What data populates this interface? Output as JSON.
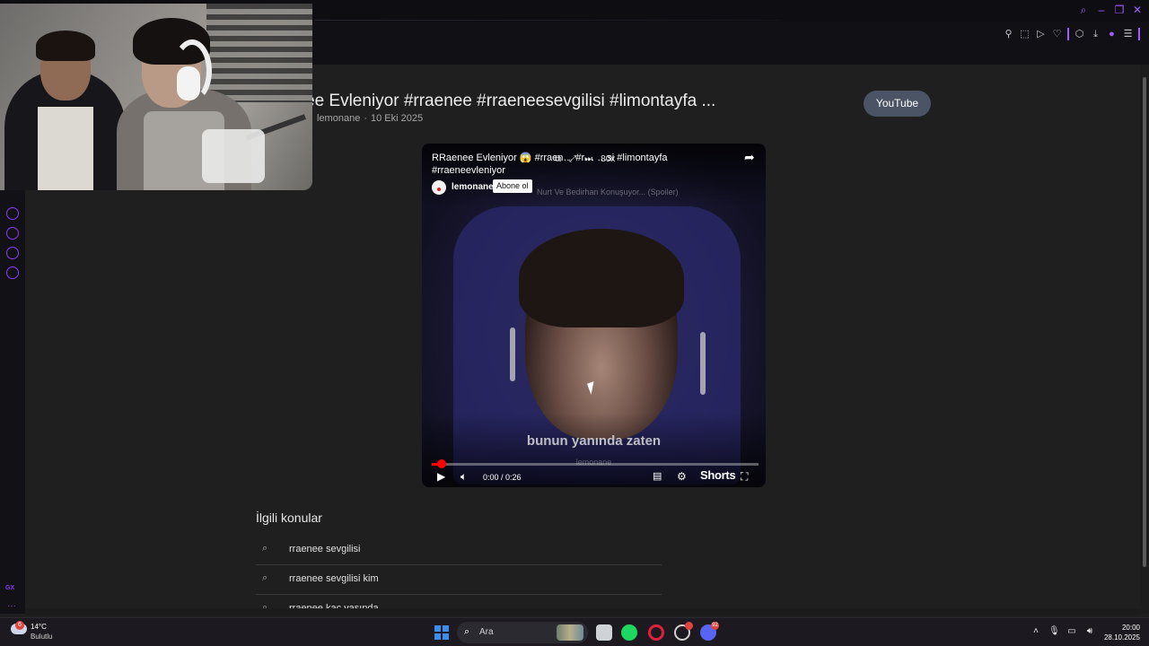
{
  "window": {
    "controls": [
      "search-icon",
      "minimize-icon",
      "restore-icon",
      "close-icon"
    ]
  },
  "toolbar": {
    "icons": [
      "bookmark-icon",
      "snapshot-icon",
      "play-icon",
      "heart-icon",
      "extensions-icon",
      "download-icon",
      "profile-icon",
      "menu-icon"
    ]
  },
  "sidebar": {
    "icons": [
      "player-icon",
      "history-icon",
      "messenger-icon",
      "settings-icon"
    ],
    "gx_label": "GX",
    "more_label": "···"
  },
  "page": {
    "title": "ee Evleniyor #rraenee #rraeneesevgilisi #limontayfa ...",
    "channel": "lemonane",
    "date": "10 Eki 2025",
    "chip_label": "YouTube"
  },
  "player": {
    "title": "RRaenee Evleniyor 😱 #rraen… #r…       …si #limontayfa #rraeneevleniyor",
    "channel": "lemonane",
    "subscribe_label": "Abone ol",
    "ghost_text": "Nurt Ve Bedirhan Konuşuyor... (Spoiler)",
    "subtitle": "bunun yanında zaten",
    "watermark": "lemonane",
    "time": "0:00 / 0:26",
    "shorts_label": "Shorts",
    "mini_label": "80x",
    "progress": 0.02
  },
  "related": {
    "title": "İlgili konular",
    "items": [
      "rraenee sevgilisi",
      "rraenee sevgilisi kim",
      "rraenee kaç yaşında"
    ]
  },
  "taskbar": {
    "temperature": "14°C",
    "condition": "Bulutlu",
    "weather_badge": "6",
    "search_label": "Ara",
    "time": "20:00",
    "date": "28.10.2025",
    "discord_badge": "92"
  },
  "colors": {
    "accent": "#a15cff",
    "progress": "#ff0000",
    "chip": "#4b5464"
  }
}
